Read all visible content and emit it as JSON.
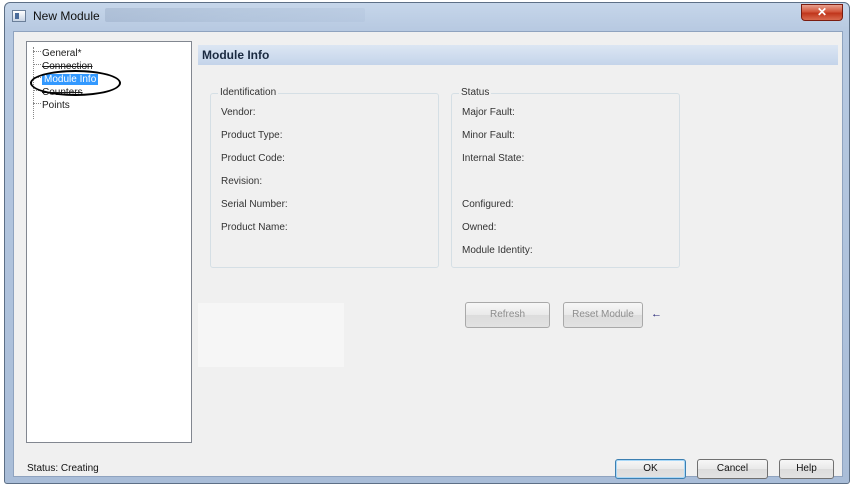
{
  "window": {
    "title": "New Module",
    "close_symbol": "✕"
  },
  "tree": {
    "items": [
      {
        "label": "General*"
      },
      {
        "label": "Connection"
      },
      {
        "label": "Module Info"
      },
      {
        "label": "Counters"
      },
      {
        "label": "Points"
      }
    ]
  },
  "panel": {
    "header": "Module Info"
  },
  "identification": {
    "legend": "Identification",
    "fields": [
      "Vendor:",
      "Product Type:",
      "Product Code:",
      "Revision:",
      "Serial Number:",
      "Product Name:"
    ]
  },
  "status_group": {
    "legend": "Status",
    "fields": [
      "Major Fault:",
      "Minor Fault:",
      "Internal State:",
      "Configured:",
      "Owned:",
      "Module Identity:"
    ]
  },
  "actions": {
    "refresh": "Refresh",
    "reset_module": "Reset Module",
    "arrow": "←"
  },
  "footer": {
    "status": "Status:  Creating",
    "ok": "OK",
    "cancel": "Cancel",
    "help": "Help"
  },
  "colors": {
    "selection": "#3399ff",
    "header_band": "#c4d4ea",
    "close_button": "#c0361c"
  }
}
